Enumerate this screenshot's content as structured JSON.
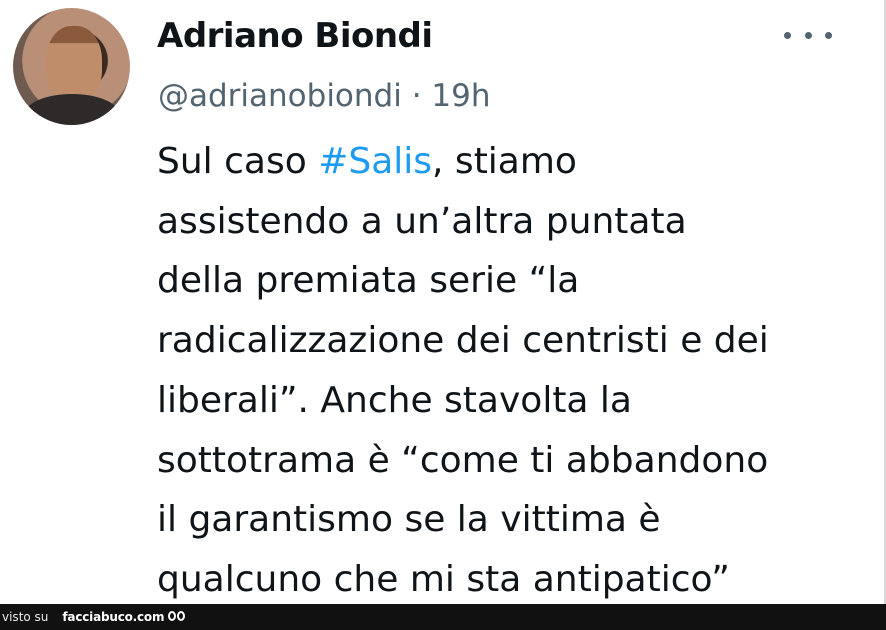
{
  "tweet": {
    "author_name": "Adriano Biondi",
    "handle_time": "@adrianobiondi · 19h",
    "text_lines": [
      {
        "before": "Sul caso ",
        "hashtag": "#Salis",
        "after": ", stiamo"
      },
      {
        "text": "assistendo a un’altra puntata"
      },
      {
        "text": "della premiata serie “la"
      },
      {
        "text": "radicalizzazione dei centristi e dei"
      },
      {
        "text": "liberali”. Anche stavolta la"
      },
      {
        "text": "sottotrama è “come ti abbandono"
      },
      {
        "text": "il garantismo se la vittima è"
      },
      {
        "text": "qualcuno che mi sta antipatico”"
      }
    ],
    "more_icon": "more-horizontal-icon",
    "hashtag_color": "#1d9bf0"
  },
  "footer": {
    "visto_label": "visto su",
    "site_label": "facciabuco.com",
    "logo_icon": "eyes-icon"
  }
}
